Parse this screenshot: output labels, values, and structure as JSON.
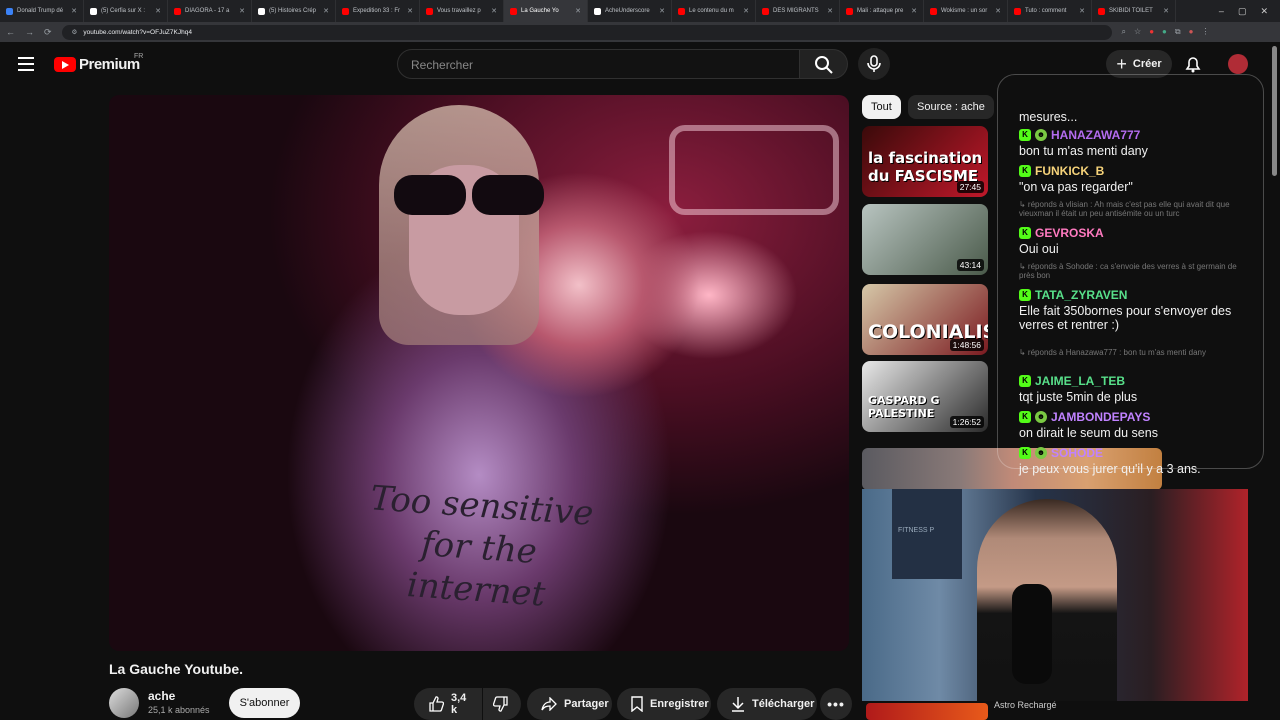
{
  "browser": {
    "tabs": [
      {
        "label": "Donald Trump dé",
        "color": "#3b82f6"
      },
      {
        "label": "(5) Cerfia sur X :",
        "color": "#ffffff"
      },
      {
        "label": "DIAGORA - 17 a",
        "color": "#ff0000"
      },
      {
        "label": "(5) Histoires Crép",
        "color": "#ffffff"
      },
      {
        "label": "Expedition 33 : Fr",
        "color": "#ff0000"
      },
      {
        "label": "Vous travaillez p",
        "color": "#ff0000"
      },
      {
        "label": "La Gauche Yo",
        "color": "#ff0000"
      },
      {
        "label": "AcheUnderscore",
        "color": "#ffffff"
      },
      {
        "label": "Le contenu du m",
        "color": "#ff0000"
      },
      {
        "label": "DES MIGRANTS",
        "color": "#ff0000"
      },
      {
        "label": "Mali : attaque pre",
        "color": "#ff0000"
      },
      {
        "label": "Wokisme : un sor",
        "color": "#ff0000"
      },
      {
        "label": "Tuto : comment",
        "color": "#ff0000"
      },
      {
        "label": "SKIBIDI TOILET",
        "color": "#ff0000"
      }
    ],
    "active_tab_index": 6,
    "url": "youtube.com/watch?v=OFJuZ7KJhq4"
  },
  "masthead": {
    "logo_text": "Premium",
    "logo_region": "FR",
    "search_placeholder": "Rechercher",
    "create_label": "Créer"
  },
  "video": {
    "title": "La Gauche Youtube.",
    "shirt_text": "Too sensitive for the internet",
    "channel": {
      "name": "ache",
      "subscribers": "25,1 k abonnés",
      "subscribe_label": "S'abonner"
    },
    "likes": "3,4 k",
    "share_label": "Partager",
    "save_label": "Enregistrer",
    "download_label": "Télécharger"
  },
  "chips": {
    "all": "Tout",
    "source": "Source : ache"
  },
  "recommendations": [
    {
      "duration": "27:45",
      "thumb_text": "la fascination du FASCISME",
      "colors": [
        "#3a0a0a",
        "#c0182a"
      ]
    },
    {
      "duration": "43:14",
      "thumb_text": "",
      "colors": [
        "#b8c4c0",
        "#4a5a4a"
      ]
    },
    {
      "duration": "1:48:56",
      "thumb_text": "COLONIALISME",
      "colors": [
        "#d6c8a8",
        "#7a1a20"
      ]
    },
    {
      "duration": "1:26:52",
      "thumb_text": "GASPARD G PALESTINE",
      "colors": [
        "#e8e8e8",
        "#2a2a2a"
      ]
    }
  ],
  "chat": [
    {
      "type": "reply",
      "text": "mesures..."
    },
    {
      "type": "msg",
      "user": "HANAZAWA777",
      "color": "#b46cf0",
      "text": "bon tu m'as menti dany"
    },
    {
      "type": "msg",
      "user": "FUNKICK_B",
      "color": "#f6d37a",
      "text": "\"on va pas regarder\""
    },
    {
      "type": "reply",
      "text": "↳ réponds à vlisian : Ah mais c'est pas elle qui avait dit que vieuxman il était un peu antisémite ou un turc"
    },
    {
      "type": "msg",
      "user": "GEVROSKA",
      "color": "#ff7ac0",
      "text": "Oui oui"
    },
    {
      "type": "reply",
      "text": "↳ réponds à Sohode : ca s'envoie des verres à st germain de près bon"
    },
    {
      "type": "msg",
      "user": "TATA_ZYRAVEN",
      "color": "#58e08a",
      "text": "Elle fait 350bornes pour s'envoyer des verres et rentrer :)"
    },
    {
      "type": "reply",
      "text": "↳ réponds à Hanazawa777 : bon tu m'as menti dany"
    },
    {
      "type": "msg",
      "user": "JAIME_LA_TEB",
      "color": "#58e08a",
      "text": "tqt juste 5min de plus"
    },
    {
      "type": "msg",
      "user": "JAMBONDEPAYS",
      "color": "#c082ff",
      "text": "on dirait le seum du sens"
    },
    {
      "type": "msg",
      "user": "SOHODE",
      "color": "#c082ff",
      "text": "je peux vous jurer qu'il y a 3 ans."
    }
  ],
  "webcam": {
    "poster_text": "FITNESS P"
  },
  "bottom_rec": "Astro Rechargé"
}
